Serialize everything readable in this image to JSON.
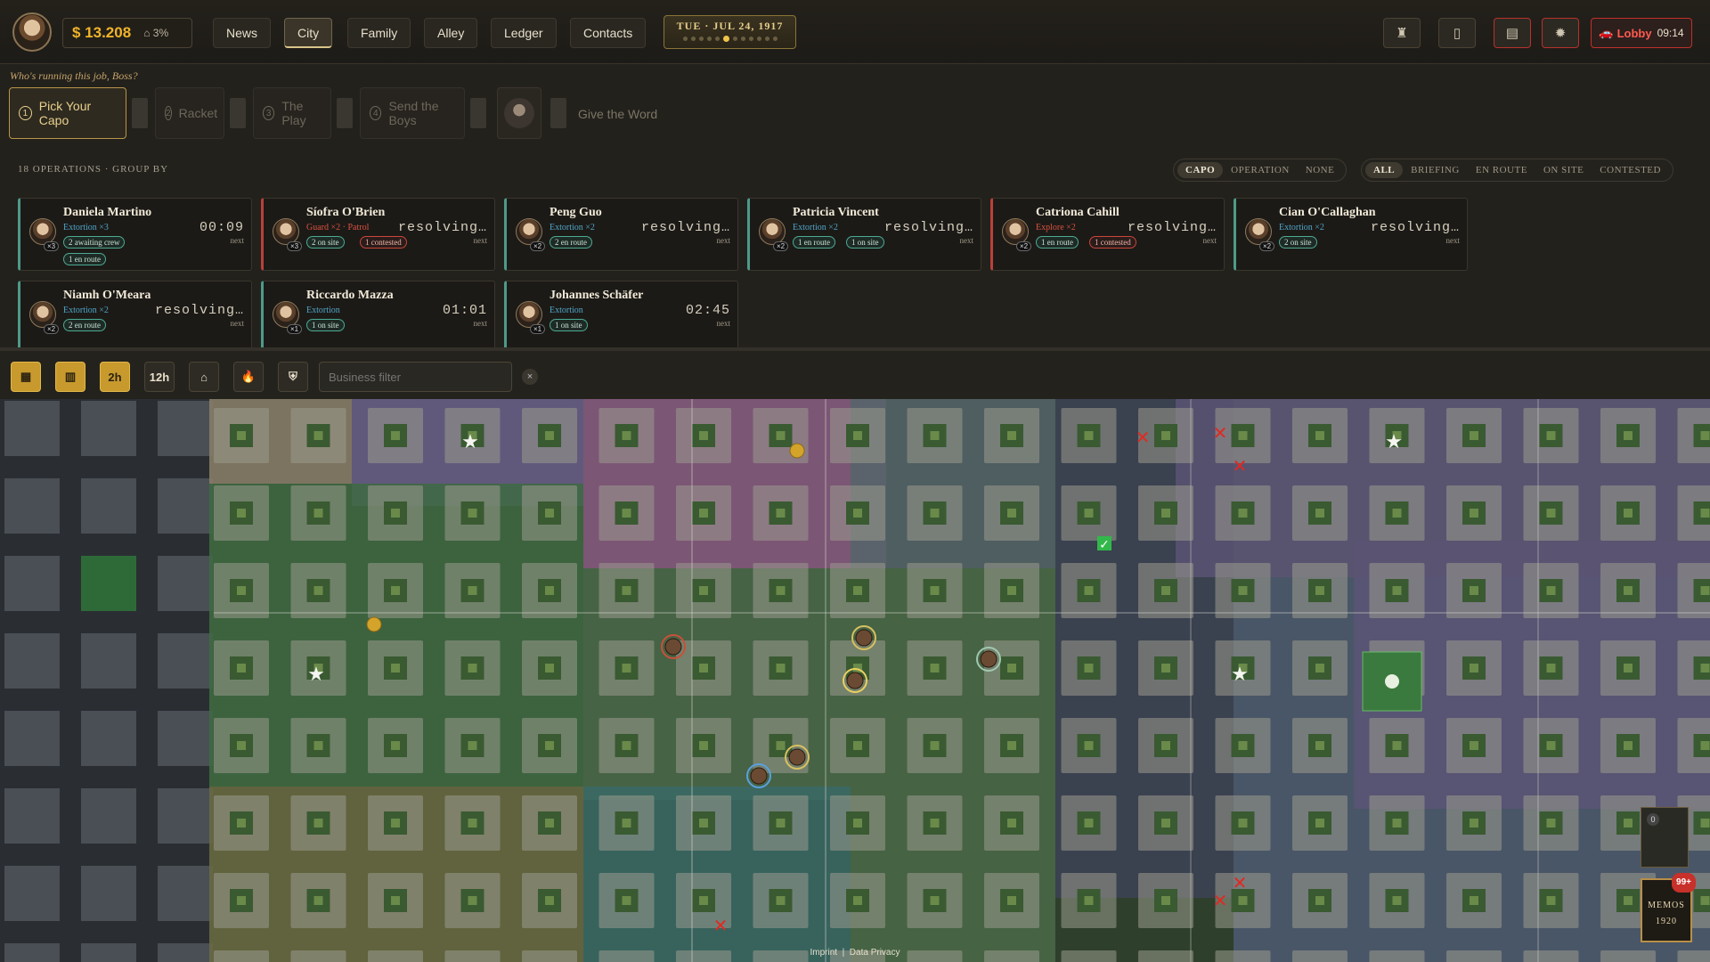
{
  "header": {
    "cash": "$ 13.208",
    "heat": "3%",
    "nav": [
      "News",
      "City",
      "Family",
      "Alley",
      "Ledger",
      "Contacts"
    ],
    "active_nav": "City",
    "date": "TUE · JUL 24, 1917",
    "lobby_label": "Lobby",
    "lobby_time": "09:14"
  },
  "job": {
    "prompt": "Who's running this job, Boss?",
    "steps": [
      {
        "num": "1",
        "label": "Pick Your Capo"
      },
      {
        "num": "2",
        "label": "Racket"
      },
      {
        "num": "3",
        "label": "The Play"
      },
      {
        "num": "4",
        "label": "Send the Boys"
      }
    ],
    "final_label": "Give the Word"
  },
  "operations": {
    "count_label": "18 OPERATIONS · GROUP BY",
    "group_by": [
      "CAPO",
      "OPERATION",
      "NONE"
    ],
    "group_selected": "CAPO",
    "status_filter": [
      "ALL",
      "BRIEFING",
      "EN ROUTE",
      "ON SITE",
      "CONTESTED"
    ],
    "status_selected": "ALL",
    "cards": [
      {
        "name": "Daniela Martino",
        "role": "Extortion ×3",
        "time": "00:09",
        "next": "next",
        "count": "×3",
        "red": false,
        "pills": [
          [
            "2 awaiting crew",
            false
          ],
          [
            "1 en route",
            false
          ]
        ]
      },
      {
        "name": "Síofra O'Brien",
        "role": "Guard ×2 · Patrol",
        "time": "resolving…",
        "next": "next",
        "count": "×3",
        "red": true,
        "pills": [
          [
            "2 on site",
            false
          ],
          [
            "1 contested",
            true
          ]
        ]
      },
      {
        "name": "Peng Guo",
        "role": "Extortion ×2",
        "time": "resolving…",
        "next": "next",
        "count": "×2",
        "red": false,
        "pills": [
          [
            "2 en route",
            false
          ]
        ]
      },
      {
        "name": "Patricia Vincent",
        "role": "Extortion ×2",
        "time": "resolving…",
        "next": "next",
        "count": "×2",
        "red": false,
        "pills": [
          [
            "1 en route",
            false
          ],
          [
            "1 on site",
            false
          ]
        ]
      },
      {
        "name": "Catriona Cahill",
        "role": "Explore ×2",
        "time": "resolving…",
        "next": "next",
        "count": "×2",
        "red": true,
        "pills": [
          [
            "1 en route",
            false
          ],
          [
            "1 contested",
            true
          ]
        ]
      },
      {
        "name": "Cian O'Callaghan",
        "role": "Extortion ×2",
        "time": "resolving…",
        "next": "next",
        "count": "×2",
        "red": false,
        "pills": [
          [
            "2 on site",
            false
          ]
        ]
      },
      {
        "name": "Niamh O'Meara",
        "role": "Extortion ×2",
        "time": "resolving…",
        "next": "next",
        "count": "×2",
        "red": false,
        "pills": [
          [
            "2 en route",
            false
          ]
        ]
      },
      {
        "name": "Riccardo Mazza",
        "role": "Extortion",
        "time": "01:01",
        "next": "next",
        "count": "×1",
        "red": false,
        "pills": [
          [
            "1 on site",
            false
          ]
        ]
      },
      {
        "name": "Johannes Schäfer",
        "role": "Extortion",
        "time": "02:45",
        "next": "next",
        "count": "×1",
        "red": false,
        "pills": [
          [
            "1 on site",
            false
          ]
        ]
      }
    ]
  },
  "mapbar": {
    "time_2h": "2h",
    "time_12h": "12h",
    "filter_placeholder": "Business filter",
    "clear": "×"
  },
  "memos": {
    "label": "MEMOS",
    "year": "1920",
    "badge": "99+",
    "zero": "0"
  },
  "footer": {
    "imprint": "Imprint",
    "sep": "|",
    "privacy": "Data Privacy"
  },
  "colors": {
    "gold": "#f0b429",
    "teal": "#4d9a8a",
    "red": "#b8413a"
  }
}
